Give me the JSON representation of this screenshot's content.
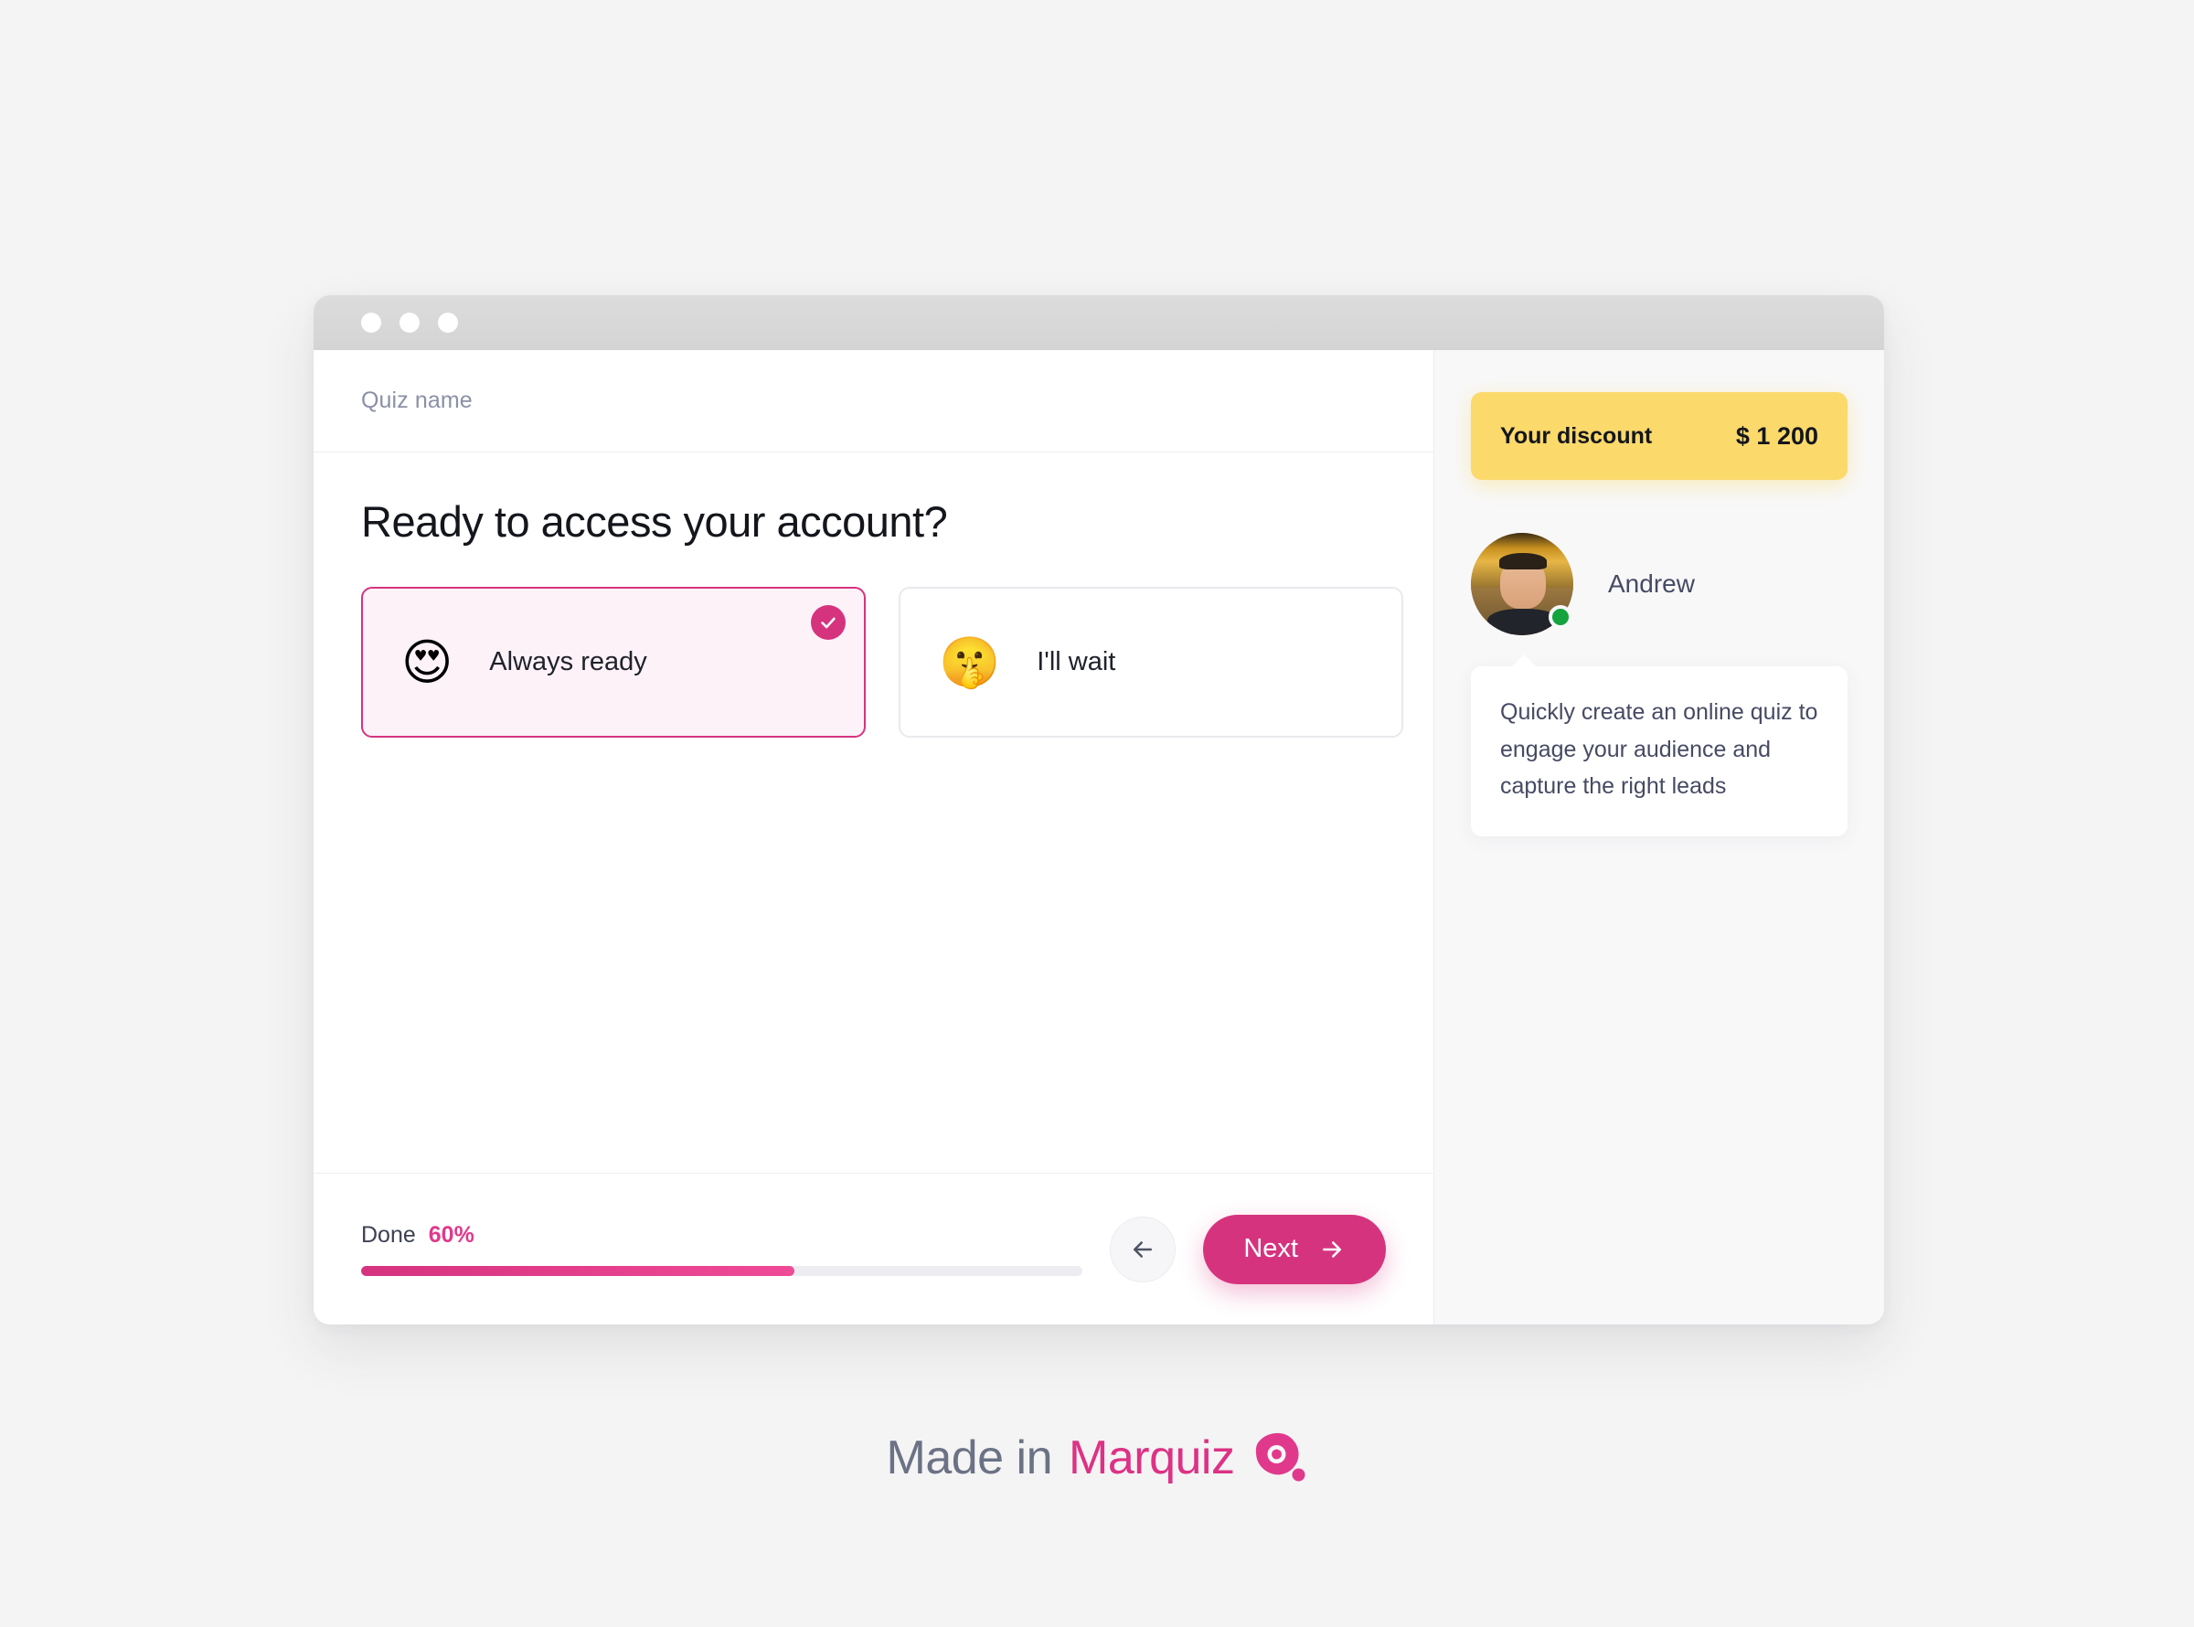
{
  "window": {
    "title_dots": [
      "dot-1",
      "dot-2",
      "dot-3"
    ]
  },
  "quiz": {
    "quiz_name_label": "Quiz name",
    "question": "Ready to access your account?",
    "options": [
      {
        "emoji": "😍",
        "emoji_name": "smiling-face-with-heart-eyes",
        "label": "Always ready",
        "selected": true
      },
      {
        "emoji": "🤫",
        "emoji_name": "shushing-face",
        "label": "I'll wait",
        "selected": false
      }
    ],
    "progress": {
      "done_label": "Done",
      "percent_text": "60%",
      "percent_value": 60
    },
    "nav": {
      "back_icon": "arrow-left-icon",
      "next_label": "Next",
      "next_icon": "arrow-right-icon"
    }
  },
  "sidebar": {
    "discount": {
      "label": "Your discount",
      "value": "$ 1 200"
    },
    "person": {
      "name": "Andrew",
      "status": "online"
    },
    "message": "Quickly create an online quiz to engage your audience and capture the right leads"
  },
  "brand": {
    "made_in": "Made in",
    "name": "Marquiz",
    "logo_name": "marquiz-logo-icon"
  },
  "colors": {
    "accent_pink": "#d6337f",
    "accent_pink_light": "#ef4a97",
    "brand_pink": "#dd3285",
    "discount_yellow": "#fbd96b",
    "online_green": "#14a33c",
    "muted_text": "#8b90a6",
    "body_text": "#464a63",
    "page_bg": "#f4f4f4",
    "side_bg": "#f8f8f9"
  }
}
